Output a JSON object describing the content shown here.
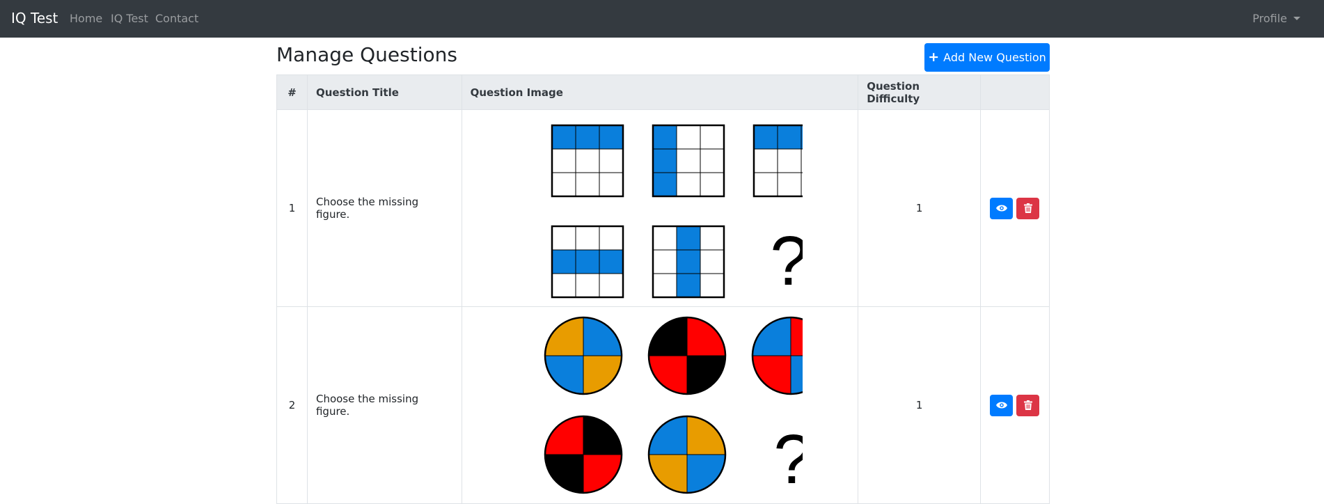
{
  "navbar": {
    "brand": "IQ Test",
    "links": [
      "Home",
      "IQ Test",
      "Contact"
    ],
    "profile": "Profile"
  },
  "page": {
    "title": "Manage Questions",
    "add_button": "Add New Question"
  },
  "table": {
    "headers": [
      "#",
      "Question Title",
      "Question Image",
      "Question Difficulty",
      ""
    ],
    "rows": [
      {
        "num": "1",
        "title": "Choose the missing figure.",
        "difficulty": "1",
        "image_question_mark": "?"
      },
      {
        "num": "2",
        "title": "Choose the missing figure.",
        "difficulty": "1",
        "image_question_mark": "?"
      }
    ]
  },
  "colors": {
    "navbar_bg": "#343a40",
    "primary": "#007bff",
    "danger": "#dc3545",
    "grid_blue": "#0a7fdc",
    "orange": "#e89c00",
    "red": "#ff0000",
    "black": "#000000"
  },
  "icons": {
    "add": "plus-icon",
    "view": "eye-icon",
    "delete": "trash-icon",
    "profile_menu": "caret-down-icon"
  }
}
